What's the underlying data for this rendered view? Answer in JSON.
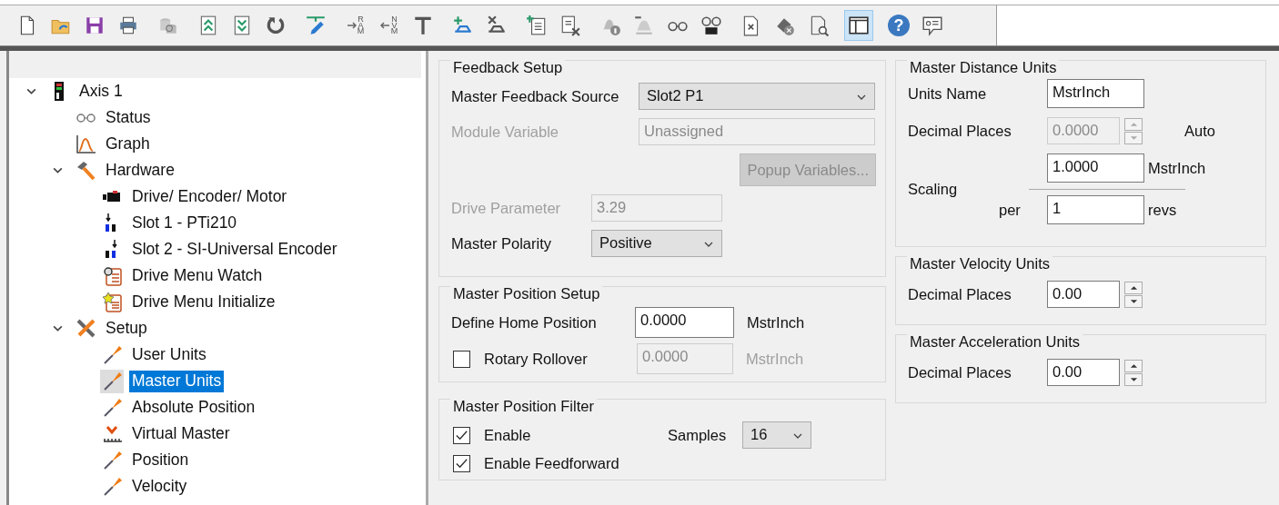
{
  "toolbar": {
    "groups": [
      [
        {
          "kind": "new",
          "pressed": false
        },
        {
          "kind": "open",
          "pressed": false
        },
        {
          "kind": "save",
          "pressed": false
        },
        {
          "kind": "print",
          "pressed": false
        }
      ],
      [
        {
          "kind": "database",
          "pressed": false
        }
      ],
      [
        {
          "kind": "upload",
          "pressed": false
        },
        {
          "kind": "download",
          "pressed": false
        },
        {
          "kind": "refresh",
          "pressed": false
        }
      ],
      [
        {
          "kind": "pen",
          "pressed": false
        }
      ],
      [
        {
          "kind": "toram",
          "letters": "RAM",
          "pressed": false
        },
        {
          "kind": "tonvm",
          "letters": "NVM",
          "pressed": false
        },
        {
          "kind": "tee",
          "pressed": false
        }
      ],
      [
        {
          "kind": "trayadd",
          "pressed": false
        },
        {
          "kind": "trayremove",
          "pressed": false
        }
      ],
      [
        {
          "kind": "listadd",
          "pressed": false
        },
        {
          "kind": "listremove",
          "pressed": false
        }
      ],
      [
        {
          "kind": "bellinfo",
          "pressed": false
        },
        {
          "kind": "belldash",
          "pressed": false
        },
        {
          "kind": "glasses",
          "pressed": false
        },
        {
          "kind": "glassesscreen",
          "pressed": false
        }
      ],
      [
        {
          "kind": "filex",
          "pressed": false
        },
        {
          "kind": "eraser",
          "pressed": false
        },
        {
          "kind": "docsearch",
          "pressed": false
        }
      ],
      [
        {
          "kind": "layout",
          "pressed": true
        }
      ],
      [
        {
          "kind": "help",
          "letters": "?",
          "pressed": false
        },
        {
          "kind": "chat",
          "pressed": false
        }
      ]
    ]
  },
  "tree": {
    "items": [
      {
        "label": "Axis 1",
        "kind": "drive",
        "expanded": true,
        "selected": false,
        "children": [
          {
            "label": "Status",
            "kind": "glasses",
            "selected": false
          },
          {
            "label": "Graph",
            "kind": "graph",
            "selected": false
          },
          {
            "label": "Hardware",
            "kind": "hammer",
            "expanded": true,
            "selected": false,
            "children": [
              {
                "label": "Drive/ Encoder/ Motor",
                "kind": "motor",
                "selected": false
              },
              {
                "label": "Slot 1 - PTi210",
                "kind": "slotleft",
                "selected": false
              },
              {
                "label": "Slot 2 - SI-Universal Encoder",
                "kind": "slotright",
                "selected": false
              },
              {
                "label": "Drive Menu Watch",
                "kind": "menuwatch",
                "selected": false
              },
              {
                "label": "Drive Menu Initialize",
                "kind": "menuinit",
                "selected": false
              }
            ]
          },
          {
            "label": "Setup",
            "kind": "tools",
            "expanded": true,
            "selected": false,
            "children": [
              {
                "label": "User Units",
                "kind": "screwdriver",
                "selected": false
              },
              {
                "label": "Master Units",
                "kind": "screwdriver",
                "selected": true
              },
              {
                "label": "Absolute Position",
                "kind": "screwdriver",
                "selected": false
              },
              {
                "label": "Virtual Master",
                "kind": "ruler",
                "selected": false
              },
              {
                "label": "Position",
                "kind": "screwdriver",
                "selected": false
              },
              {
                "label": "Velocity",
                "kind": "screwdriver",
                "selected": false
              }
            ]
          }
        ]
      }
    ]
  },
  "feedback_setup": {
    "title": "Feedback Setup",
    "master_feedback_source": {
      "label": "Master Feedback Source",
      "value": "Slot2 P1"
    },
    "module_variable": {
      "label": "Module Variable",
      "value": "Unassigned",
      "disabled": true
    },
    "popup_button": {
      "label": "Popup Variables...",
      "disabled": true
    },
    "drive_parameter": {
      "label": "Drive Parameter",
      "value": "3.29",
      "disabled": true
    },
    "master_polarity": {
      "label": "Master Polarity",
      "value": "Positive"
    }
  },
  "master_position_setup": {
    "title": "Master Position Setup",
    "define_home_position": {
      "label": "Define Home Position",
      "value": "0.0000",
      "unit": "MstrInch"
    },
    "rotary_rollover": {
      "label": "Rotary Rollover",
      "checked": false,
      "value": "0.0000",
      "unit": "MstrInch",
      "disabled": true
    }
  },
  "master_position_filter": {
    "title": "Master Position Filter",
    "enable": {
      "label": "Enable",
      "checked": true
    },
    "samples": {
      "label": "Samples",
      "value": "16"
    },
    "enable_feedforward": {
      "label": "Enable Feedforward",
      "checked": true
    }
  },
  "master_distance_units": {
    "title": "Master Distance Units",
    "units_name": {
      "label": "Units Name",
      "value": "MstrInch"
    },
    "decimal_places": {
      "label": "Decimal Places",
      "value": "0.0000",
      "disabled": true,
      "note": "Auto"
    },
    "scaling": {
      "label": "Scaling",
      "numerator": {
        "value": "1.0000",
        "unit": "MstrInch"
      },
      "per_label": "per",
      "denominator": {
        "value": "1",
        "unit": "revs"
      }
    }
  },
  "master_velocity_units": {
    "title": "Master Velocity Units",
    "decimal_places": {
      "label": "Decimal Places",
      "value": "0.00"
    }
  },
  "master_acceleration_units": {
    "title": "Master Acceleration Units",
    "decimal_places": {
      "label": "Decimal Places",
      "value": "0.00"
    }
  }
}
